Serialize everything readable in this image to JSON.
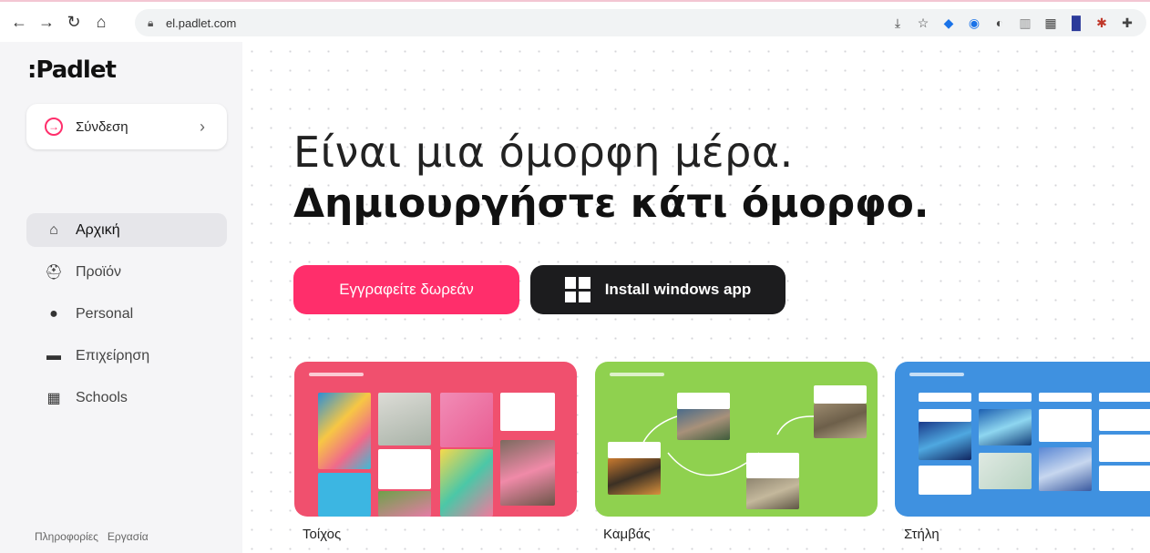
{
  "browser": {
    "url": "el.padlet.com",
    "nav_icons": [
      "back-arrow-icon",
      "forward-arrow-icon",
      "reload-icon",
      "home-icon"
    ],
    "ext_icons": [
      "install-icon",
      "star-icon",
      "ext-blue-icon",
      "ext-record-icon",
      "ext-toggle-icon",
      "ext-book-icon",
      "ext-qr-icon",
      "ext-translate-icon",
      "ext-bug-icon",
      "puzzle-icon"
    ]
  },
  "sidebar": {
    "logo": ":Padlet",
    "login_label": "Σύνδεση",
    "items": [
      {
        "label": "Αρχική",
        "icon": "home-icon"
      },
      {
        "label": "Προϊόν",
        "icon": "product-icon"
      },
      {
        "label": "Personal",
        "icon": "person-icon"
      },
      {
        "label": "Επιχείρηση",
        "icon": "business-icon"
      },
      {
        "label": "Schools",
        "icon": "schools-icon"
      }
    ],
    "footer": [
      "Πληροφορίες",
      "Εργασία"
    ]
  },
  "main": {
    "headline_light": "Είναι μια όμορφη μέρα.",
    "headline_bold": "Δημιουργήστε κάτι όμορφο.",
    "signup_button": "Εγγραφείτε δωρεάν",
    "install_button": "Install windows app",
    "cards": [
      {
        "label": "Τοίχος",
        "color": "#f0506e"
      },
      {
        "label": "Καμβάς",
        "color": "#8fd14f"
      },
      {
        "label": "Στήλη",
        "color": "#3f91e0"
      }
    ]
  },
  "colors": {
    "accent": "#ff2e6b",
    "dark_button": "#1c1c1e",
    "sidebar_bg": "#f5f5f7"
  }
}
